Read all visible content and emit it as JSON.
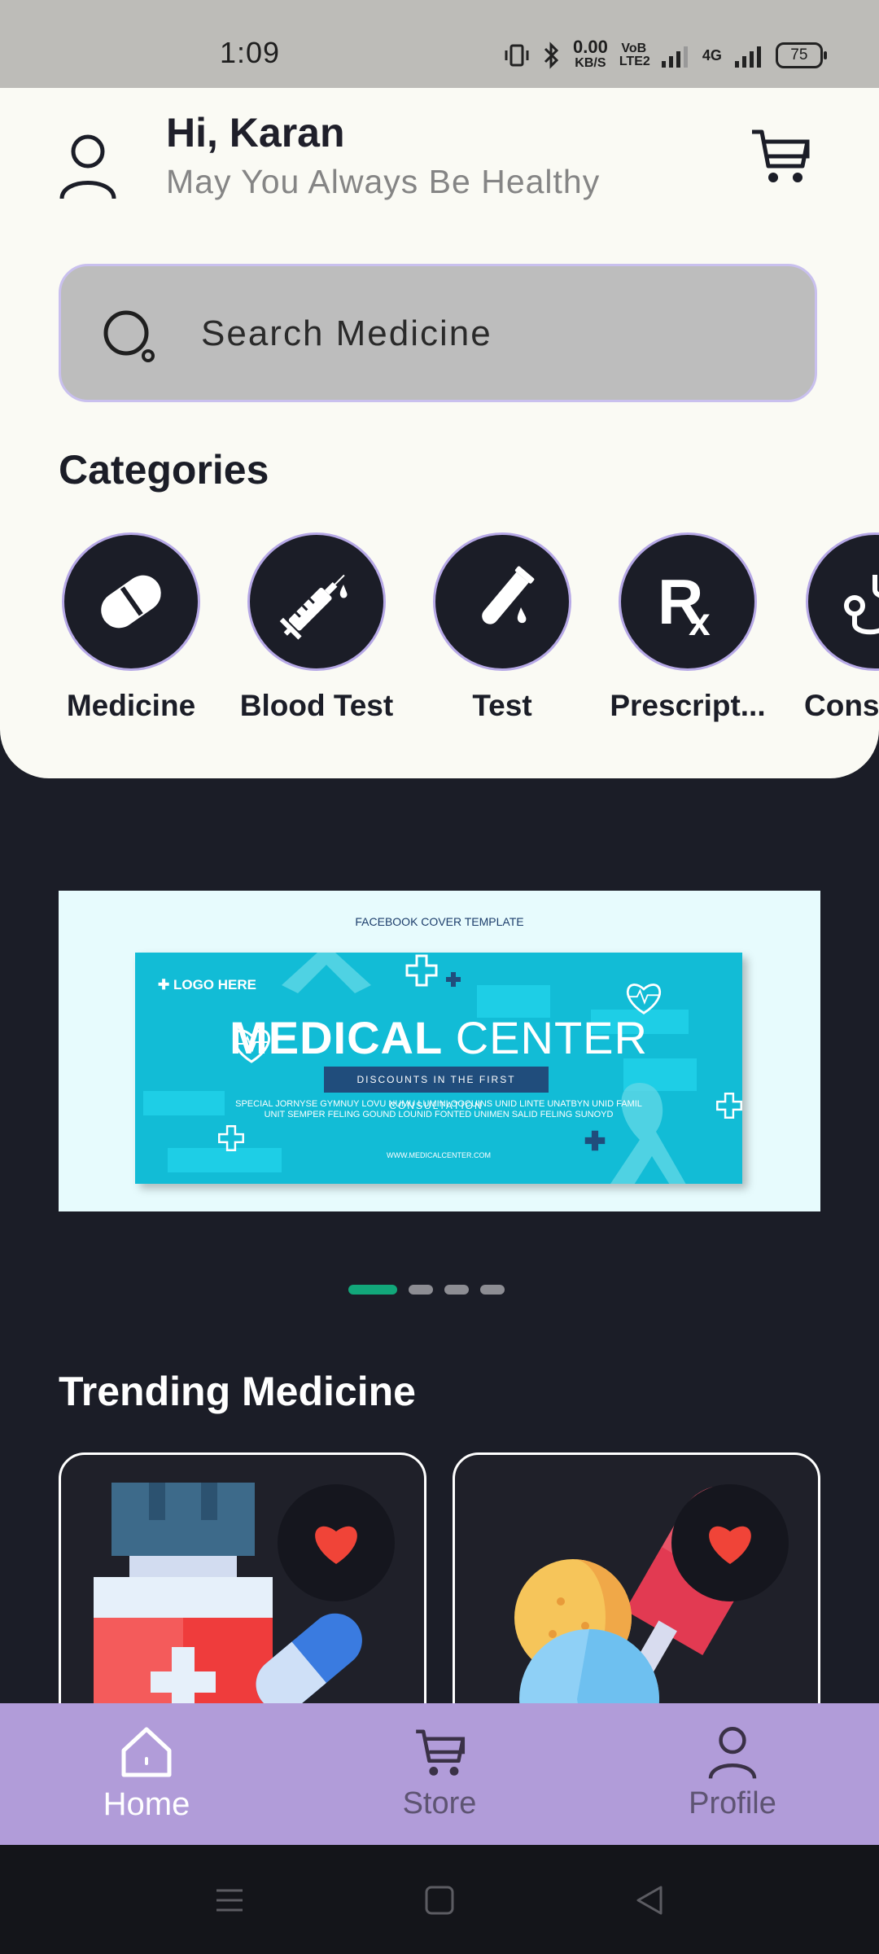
{
  "status_bar": {
    "time": "1:09",
    "net_speed": "0.00",
    "net_unit": "KB/S",
    "volte": "VoB LTE2",
    "network": "4G",
    "battery": "75"
  },
  "header": {
    "greeting": "Hi, Karan",
    "subtitle": "May You Always Be Healthy"
  },
  "search": {
    "placeholder": "Search Medicine"
  },
  "categories": {
    "title": "Categories",
    "items": [
      {
        "label": "Medicine",
        "icon": "capsule-icon"
      },
      {
        "label": "Blood Test",
        "icon": "syringe-icon"
      },
      {
        "label": "Test",
        "icon": "test-tube-icon"
      },
      {
        "label": "Prescript...",
        "icon": "rx-icon"
      },
      {
        "label": "Consu",
        "icon": "stethoscope-icon"
      }
    ]
  },
  "banner": {
    "template_label": "FACEBOOK COVER TEMPLATE",
    "logo": "LOGO HERE",
    "title_bold": "MEDICAL",
    "title_light": "CENTER",
    "pill": "DISCOUNTS IN THE FIRST CONSULTATION",
    "body": "SPECIAL JORNYSE GYMNUY  LOVU NUMU LUMINI OOCUINS UNID LINTE UNATBYN UNID FAMIL UNIT SEMPER FELING GOUND LOUNID FONTED UNIMEN SALID FELING SUNOYD",
    "url": "WWW.MEDICALCENTER.COM",
    "slide_count": 4,
    "active_slide": 1
  },
  "trending": {
    "title": "Trending Medicine"
  },
  "bottom_nav": {
    "items": [
      {
        "label": "Home",
        "active": true
      },
      {
        "label": "Store",
        "active": false
      },
      {
        "label": "Profile",
        "active": false
      }
    ]
  },
  "colors": {
    "accent": "#b19cd9",
    "dark": "#1b1d27",
    "active_dot": "#12a77a",
    "heart": "#f04438"
  }
}
